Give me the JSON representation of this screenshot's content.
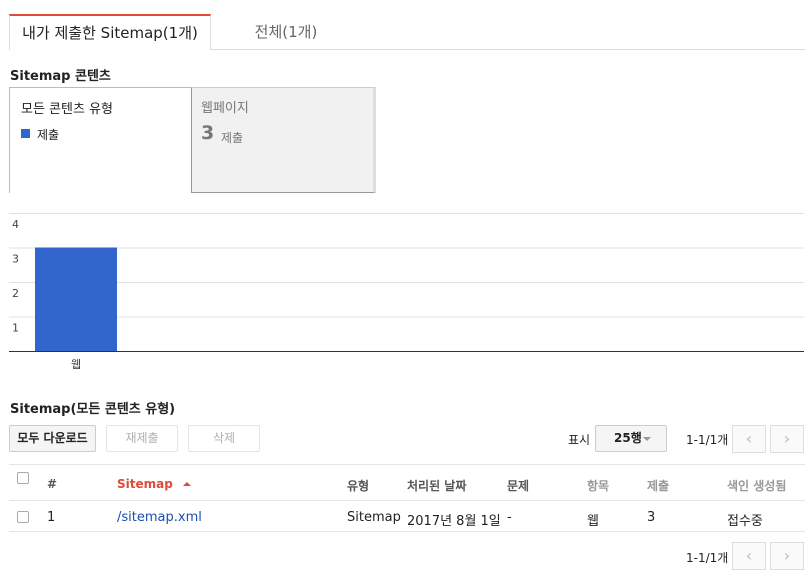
{
  "tabs": [
    {
      "label": "내가 제출한 Sitemap(1개)",
      "active": true
    },
    {
      "label": "전체(1개)",
      "active": false
    }
  ],
  "content_section": {
    "title": "Sitemap 콘텐츠",
    "box_all": {
      "title": "모든 콘텐츠 유형",
      "legend_label": "제출",
      "legend_color": "#3366cc"
    },
    "box_web": {
      "title": "웹페이지",
      "count": "3",
      "count_label": "제출"
    }
  },
  "chart_data": {
    "type": "bar",
    "categories": [
      "웹"
    ],
    "series": [
      {
        "name": "제출",
        "values": [
          3
        ],
        "color": "#3366cc"
      }
    ],
    "yticks": [
      "1",
      "2",
      "3",
      "4"
    ],
    "ylim": [
      0,
      4
    ],
    "title": "",
    "xlabel": "",
    "ylabel": ""
  },
  "table_section": {
    "title": "Sitemap(모든 콘텐츠 유형)",
    "buttons": {
      "download_all": "모두 다운로드",
      "resubmit": "재제출",
      "delete": "삭제"
    },
    "show_label": "표시",
    "rows_select": "25행",
    "range_text": "1-1/1개",
    "headers": [
      "#",
      "Sitemap",
      "유형",
      "처리된 날짜",
      "문제",
      "항목",
      "제출",
      "색인 생성됨"
    ],
    "sort_color": "#dd4b39",
    "rows": [
      {
        "num": "1",
        "sitemap": "/sitemap.xml",
        "type": "Sitemap",
        "date": "2017년 8월 1일",
        "issues": "-",
        "item": "웹",
        "submitted": "3",
        "indexed": "접수중"
      }
    ]
  },
  "footer": {
    "range_text": "1-1/1개"
  }
}
